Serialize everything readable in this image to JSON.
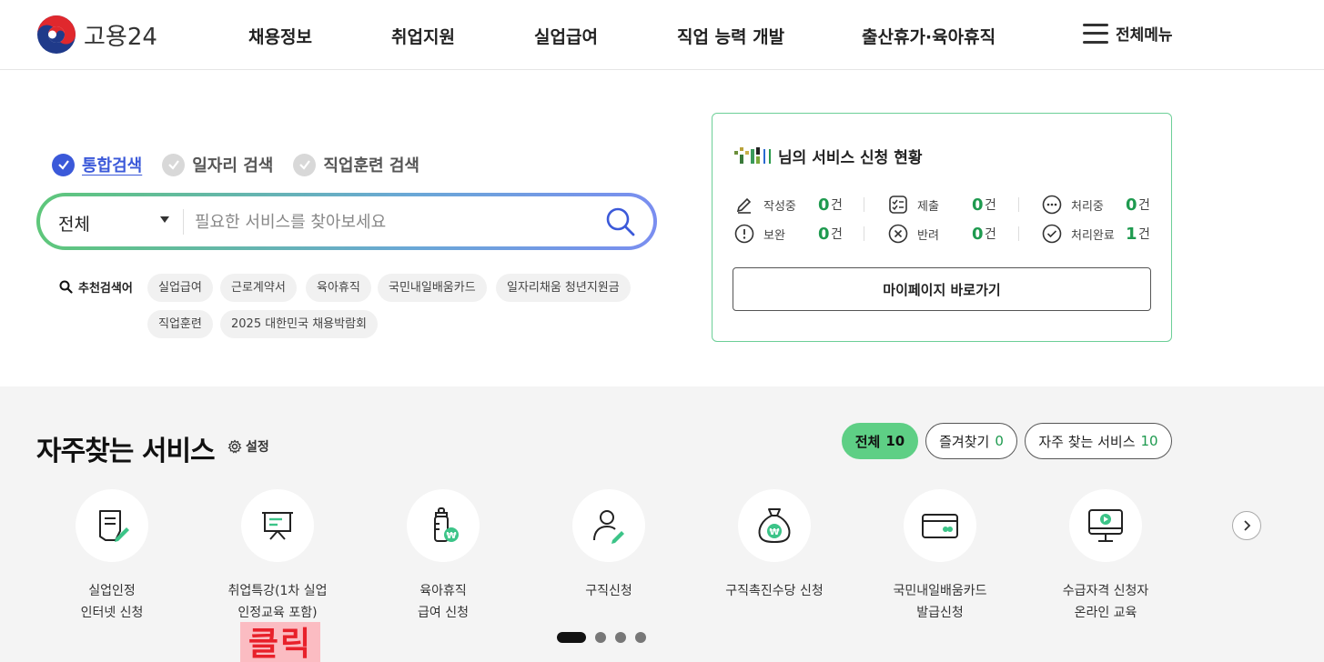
{
  "header": {
    "logo_text": "고용24",
    "nav": [
      "채용정보",
      "취업지원",
      "실업급여",
      "직업 능력 개발",
      "출산휴가·육아휴직"
    ],
    "menu_all": "전체메뉴"
  },
  "search": {
    "tabs": [
      "통합검색",
      "일자리 검색",
      "직업훈련 검색"
    ],
    "active_tab": 0,
    "select_value": "전체",
    "placeholder": "필요한 서비스를 찾아보세요",
    "recommend_label": "추천검색어",
    "chips": [
      "실업급여",
      "근로계약서",
      "육아휴직",
      "국민내일배움카드",
      "일자리채움 청년지원금",
      "직업훈련",
      "2025 대한민국 채용박람회"
    ]
  },
  "status": {
    "title": "님의 서비스 신청 현황",
    "items": [
      {
        "label": "작성중",
        "count": "0",
        "unit": "건"
      },
      {
        "label": "제출",
        "count": "0",
        "unit": "건"
      },
      {
        "label": "처리중",
        "count": "0",
        "unit": "건"
      },
      {
        "label": "보완",
        "count": "0",
        "unit": "건"
      },
      {
        "label": "반려",
        "count": "0",
        "unit": "건"
      },
      {
        "label": "처리완료",
        "count": "1",
        "unit": "건"
      }
    ],
    "mypage_label": "마이페이지 바로가기"
  },
  "frequent": {
    "title": "자주찾는 서비스",
    "setting_label": "설정",
    "filters": [
      {
        "label": "전체",
        "count": "10"
      },
      {
        "label": "즐겨찾기",
        "count": "0"
      },
      {
        "label": "자주 찾는 서비스",
        "count": "10"
      }
    ],
    "services": [
      {
        "line1": "실업인정",
        "line2": "인터넷 신청",
        "icon": "document-pen-icon"
      },
      {
        "line1": "취업특강(1차 실업",
        "line2": "인정교육 포함)",
        "icon": "presentation-board-icon"
      },
      {
        "line1": "육아휴직",
        "line2": "급여 신청",
        "icon": "baby-bottle-icon"
      },
      {
        "line1": "구직신청",
        "line2": "",
        "icon": "person-pen-icon"
      },
      {
        "line1": "구직촉진수당 신청",
        "line2": "",
        "icon": "money-bag-icon"
      },
      {
        "line1": "국민내일배움카드",
        "line2": "발급신청",
        "icon": "card-icon"
      },
      {
        "line1": "수급자격 신청자",
        "line2": "온라인 교육",
        "icon": "monitor-play-icon"
      }
    ],
    "annotation": "클릭"
  },
  "colors": {
    "accent_blue": "#3b59d9",
    "accent_green": "#5ecf85",
    "count_green": "#1e9a4f"
  }
}
